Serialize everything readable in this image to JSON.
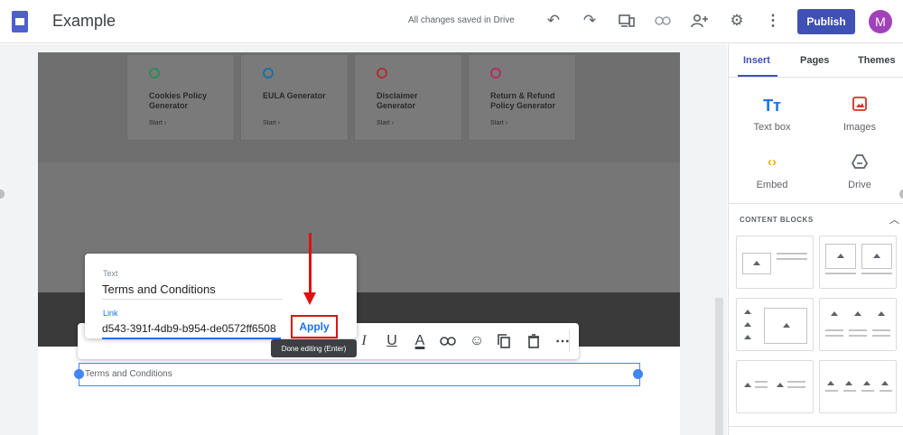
{
  "topbar": {
    "doc_title": "Example",
    "save_status": "All changes saved in Drive",
    "publish_label": "Publish",
    "avatar_letter": "M"
  },
  "cards": [
    {
      "title": "Cookies Policy Generator",
      "start": "Start ›",
      "color": "#2e8b57"
    },
    {
      "title": "EULA Generator",
      "start": "Start ›",
      "color": "#1e6fa0"
    },
    {
      "title": "Disclaimer Generator",
      "start": "Start ›",
      "color": "#b03030"
    },
    {
      "title": "Return & Refund Policy Generator",
      "start": "Start ›",
      "color": "#b03060"
    }
  ],
  "link_popup": {
    "text_label": "Text",
    "text_value": "Terms and Conditions",
    "link_label": "Link",
    "link_value": "d543-391f-4db9-b954-de0572ff6508",
    "apply_label": "Apply"
  },
  "tooltip": "Done editing (Enter)",
  "text_box": {
    "content": "Terms and Conditions"
  },
  "format_toolbar": {
    "italic": "I",
    "underline": "U",
    "text_color": "A"
  },
  "panel": {
    "tabs": [
      "Insert",
      "Pages",
      "Themes"
    ],
    "active_tab": "Insert",
    "insert_items": [
      {
        "label": "Text box",
        "icon": "text-box-icon"
      },
      {
        "label": "Images",
        "icon": "images-icon"
      },
      {
        "label": "Embed",
        "icon": "embed-icon"
      },
      {
        "label": "Drive",
        "icon": "drive-icon"
      }
    ],
    "content_blocks_title": "CONTENT BLOCKS"
  },
  "colors": {
    "accent": "#3f51b5",
    "link_blue": "#1a73e8",
    "highlight_red": "#e01010",
    "avatar": "#a142b8"
  }
}
